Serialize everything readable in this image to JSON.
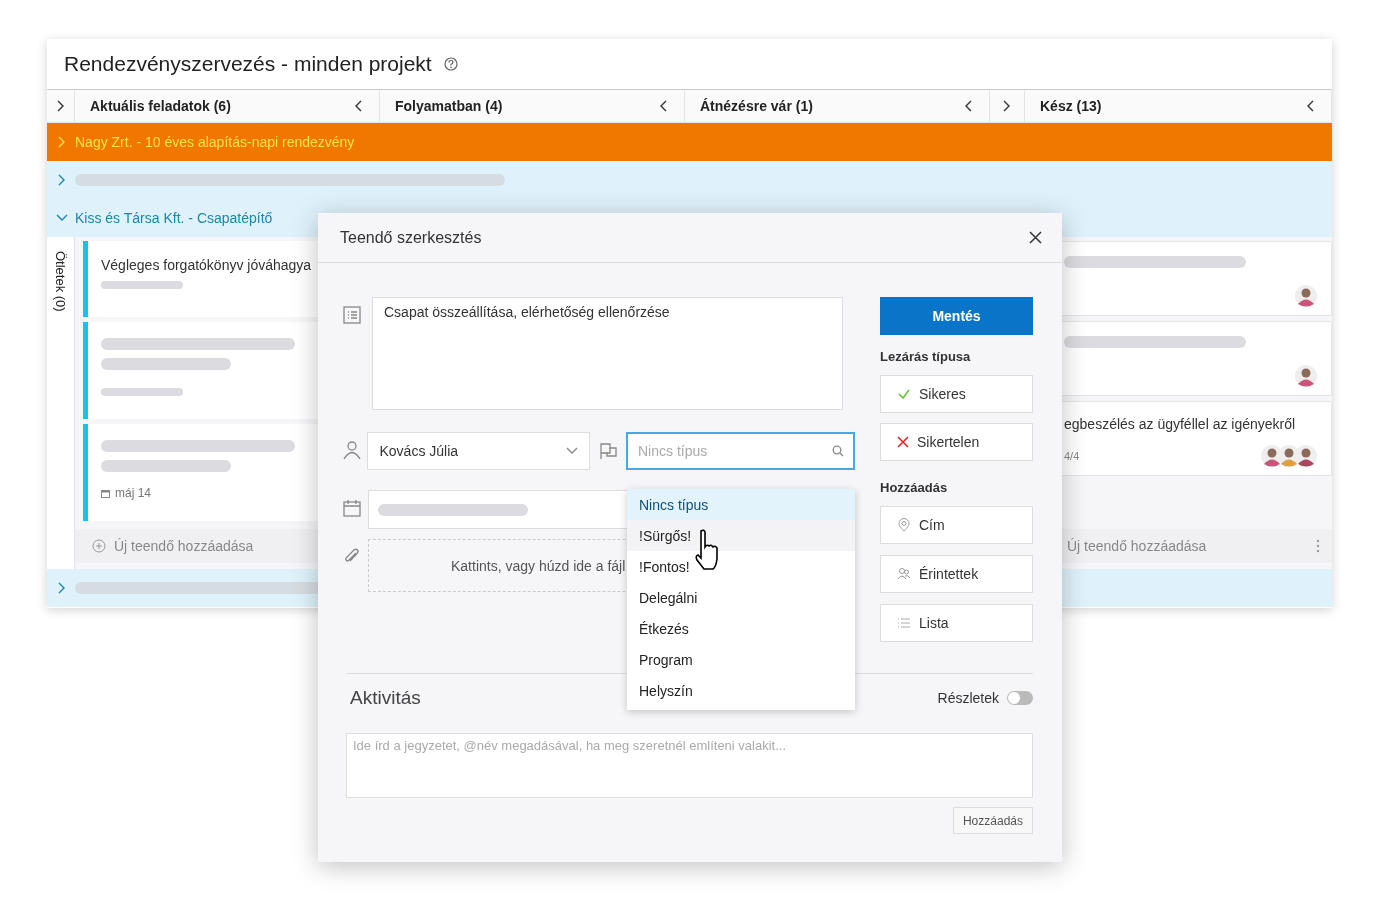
{
  "page": {
    "title": "Rendezvényszervezés - minden projekt"
  },
  "columns": [
    {
      "kind": "collapsed"
    },
    {
      "kind": "open",
      "label": "Aktuális feladatok (6)"
    },
    {
      "kind": "open",
      "label": "Folyamatban (4)"
    },
    {
      "kind": "open",
      "label": "Átnézésre vár (1)"
    },
    {
      "kind": "collapsed"
    },
    {
      "kind": "open",
      "label": "Kész (13)"
    }
  ],
  "projects": [
    {
      "title": "Nagy Zrt. - 10 éves alapítás-napi rendezvény",
      "highlighted": true,
      "expanded": false
    },
    {
      "highlighted": false,
      "expanded": false
    },
    {
      "title": "Kiss és Társa Kft. - Csapatépítő",
      "highlighted": false,
      "expanded": true,
      "side_label": "Ötletek (0)",
      "left_cards": [
        {
          "kind": "task",
          "title": "Végleges forgatókönyv jóváhagya"
        },
        {
          "kind": "skeleton"
        },
        {
          "kind": "skeleton",
          "date": "máj 14"
        }
      ],
      "left_add": "Új teendő hozzáadása",
      "right_cards": [
        {
          "avatars": [
            {
              "kind": "person"
            }
          ]
        },
        {
          "avatars": [
            {
              "kind": "person"
            }
          ]
        },
        {
          "title": "egbeszélés az ügyféllel az igényekről",
          "progress": "4/4",
          "avatars": [
            {
              "kind": "person"
            },
            {
              "kind": "person"
            },
            {
              "kind": "person"
            }
          ]
        }
      ],
      "right_add": "Új teendő hozzáadása"
    },
    {
      "highlighted": false,
      "expanded": false
    }
  ],
  "dialog": {
    "title": "Teendő szerkesztés",
    "description": "Csapat összeállítása, elérhetőség ellenőrzése",
    "assignee": "Kovács Júlia",
    "type_field": {
      "placeholder": "Nincs típus",
      "focused": true
    },
    "type_options": [
      {
        "label": "Nincs típus",
        "selected": true,
        "hovered": false
      },
      {
        "label": "!Sürgős!",
        "selected": false,
        "hovered": true
      },
      {
        "label": "!Fontos!",
        "selected": false,
        "hovered": false
      },
      {
        "label": "Delegálni",
        "selected": false,
        "hovered": false
      },
      {
        "label": "Étkezés",
        "selected": false,
        "hovered": false
      },
      {
        "label": "Program",
        "selected": false,
        "hovered": false
      },
      {
        "label": "Helyszín",
        "selected": false,
        "hovered": false
      }
    ],
    "drop_text": "Kattints, vagy húzd ide a fájl",
    "save": "Mentés",
    "close_heading": "Lezárás típusa",
    "close_types": [
      {
        "kind": "success",
        "label": "Sikeres"
      },
      {
        "kind": "failure",
        "label": "Sikertelen"
      }
    ],
    "add_heading": "Hozzáadás",
    "add_buttons": [
      {
        "kind": "address",
        "label": "Cím"
      },
      {
        "kind": "people",
        "label": "Érintettek"
      },
      {
        "kind": "list",
        "label": "Lista"
      }
    ],
    "activity": {
      "heading": "Aktivitás",
      "details_label": "Részletek",
      "details_on": false,
      "note_placeholder": "Ide írd a jegyzetet, @név megadásával, ha meg szeretnél említeni valakit...",
      "add_button": "Hozzáadás"
    }
  }
}
